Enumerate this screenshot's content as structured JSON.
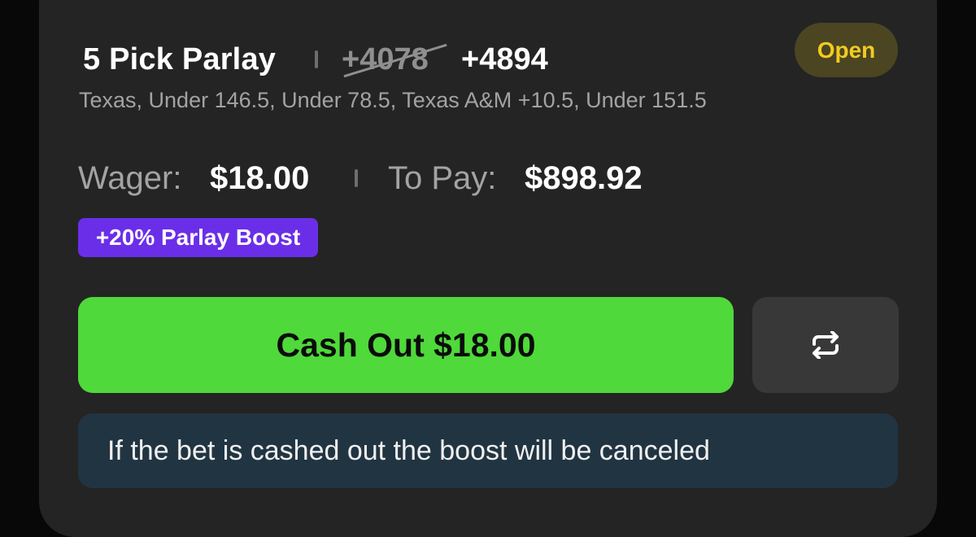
{
  "bet": {
    "title": "5 Pick Parlay",
    "original_odds": "+4078",
    "boosted_odds": "+4894",
    "status": "Open",
    "legs_summary": "Texas, Under 146.5, Under 78.5, Texas A&M +10.5, Under 151.5",
    "wager_label": "Wager:",
    "wager_value": "$18.00",
    "to_pay_label": "To Pay:",
    "to_pay_value": "$898.92",
    "boost_badge": "+20% Parlay Boost"
  },
  "actions": {
    "cash_out_label": "Cash Out $18.00",
    "swap_icon": "swap-arrows-icon"
  },
  "notice": {
    "text": "If the bet is cashed out the boost will be canceled"
  },
  "colors": {
    "card_bg": "#242424",
    "status_bg": "#4b4522",
    "status_text": "#f2cb20",
    "boost_bg": "#6b2ee8",
    "cash_out_bg": "#4fd93a",
    "notice_bg": "#213442"
  }
}
